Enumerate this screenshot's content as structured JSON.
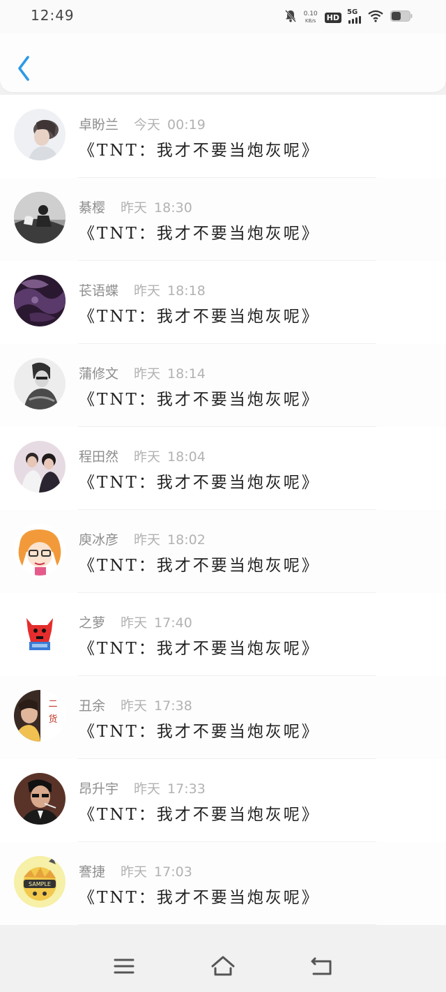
{
  "status_bar": {
    "time": "12:49",
    "net_speed_value": "0.10",
    "net_speed_unit": "KB/s",
    "hd_label": "HD",
    "network_label": "5G",
    "icons": [
      "mute-bell-icon",
      "wifi-icon",
      "battery-icon"
    ]
  },
  "header": {
    "back_icon": "chevron-left-icon",
    "accent": "#2b9ae6"
  },
  "list": {
    "items": [
      {
        "name": "卓盼兰",
        "date": "今天",
        "time": "00:19",
        "title": "《TNT：我才不要当炮灰呢》"
      },
      {
        "name": "綦樱",
        "date": "昨天",
        "time": "18:30",
        "title": "《TNT：我才不要当炮灰呢》"
      },
      {
        "name": "苌语蝶",
        "date": "昨天",
        "time": "18:18",
        "title": "《TNT：我才不要当炮灰呢》"
      },
      {
        "name": "蒲修文",
        "date": "昨天",
        "time": "18:14",
        "title": "《TNT：我才不要当炮灰呢》"
      },
      {
        "name": "程田然",
        "date": "昨天",
        "time": "18:04",
        "title": "《TNT：我才不要当炮灰呢》"
      },
      {
        "name": "庾冰彦",
        "date": "昨天",
        "time": "18:02",
        "title": "《TNT：我才不要当炮灰呢》"
      },
      {
        "name": "之萝",
        "date": "昨天",
        "time": "17:40",
        "title": "《TNT：我才不要当炮灰呢》"
      },
      {
        "name": "丑余",
        "date": "昨天",
        "time": "17:38",
        "title": "《TNT：我才不要当炮灰呢》"
      },
      {
        "name": "昂升宇",
        "date": "昨天",
        "time": "17:33",
        "title": "《TNT：我才不要当炮灰呢》"
      },
      {
        "name": "謇捷",
        "date": "昨天",
        "time": "17:03",
        "title": "《TNT：我才不要当炮灰呢》"
      }
    ]
  },
  "avatar_texts": {
    "item_8_side_text": "二货",
    "item_10_stamp": "SAMPLE"
  },
  "bottom_nav": {
    "icons": [
      "menu-icon",
      "home-icon",
      "back-icon"
    ]
  }
}
